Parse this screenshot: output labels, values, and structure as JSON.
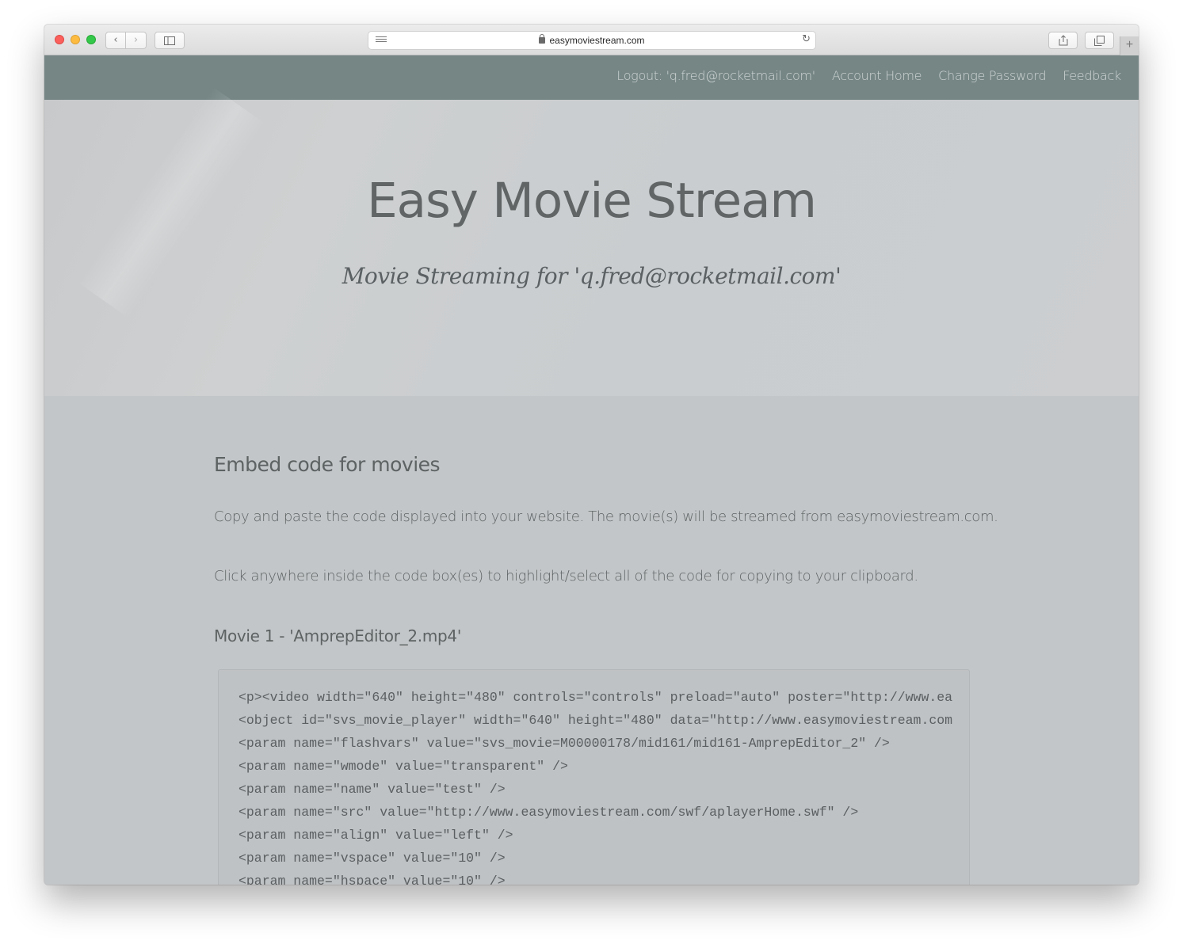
{
  "browser": {
    "url": "easymoviestream.com",
    "new_tab_label": "+"
  },
  "nav": {
    "logout": "Logout: 'q.fred@rocketmail.com'",
    "account_home": "Account Home",
    "change_password": "Change Password",
    "feedback": "Feedback"
  },
  "hero": {
    "title": "Easy Movie Stream",
    "subtitle": "Movie Streaming for 'q.fred@rocketmail.com'"
  },
  "main": {
    "heading": "Embed code for movies",
    "paragraph1": "Copy and paste the code displayed into your website. The movie(s) will be streamed from easymoviestream.com.",
    "paragraph2": "Click anywhere inside the code box(es) to highlight/select all of the code for copying to your clipboard.",
    "movie1_title": "Movie 1 - 'AmprepEditor_2.mp4'",
    "code_lines": [
      "<p><video width=\"640\" height=\"480\" controls=\"controls\" preload=\"auto\" poster=\"http://www.ea",
      "<object id=\"svs_movie_player\" width=\"640\" height=\"480\" data=\"http://www.easymoviestream.com",
      "<param name=\"flashvars\" value=\"svs_movie=M00000178/mid161/mid161-AmprepEditor_2\" />",
      "<param name=\"wmode\" value=\"transparent\" />",
      "<param name=\"name\" value=\"test\" />",
      "<param name=\"src\" value=\"http://www.easymoviestream.com/swf/aplayerHome.swf\" />",
      "<param name=\"align\" value=\"left\" />",
      "<param name=\"vspace\" value=\"10\" />",
      "<param name=\"hspace\" value=\"10\" />"
    ]
  },
  "colors": {
    "nav_bar": "#758685",
    "hero_bg": "#cbcecf",
    "main_bg": "#c3c6c8",
    "code_bg": "#bfc2c4",
    "text": "#5e6465"
  }
}
